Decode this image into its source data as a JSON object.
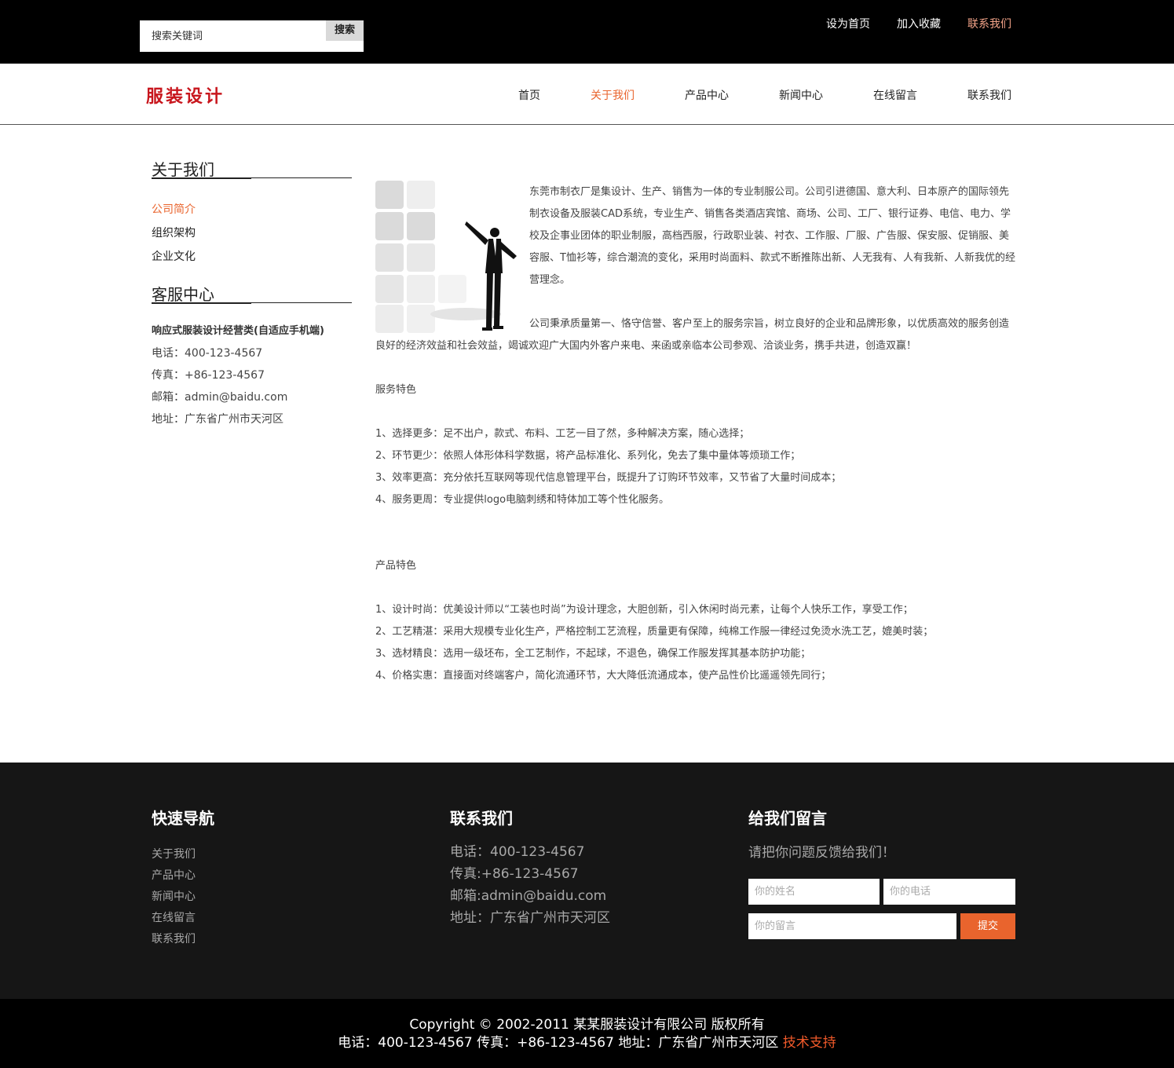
{
  "topbar": {
    "search_placeholder": "搜索关键词",
    "search_button": "搜索",
    "links": [
      "设为首页",
      "加入收藏",
      "联系我们"
    ],
    "active_link": "联系我们"
  },
  "brand": {
    "logo_text": "服装设计"
  },
  "nav": {
    "items": [
      "首页",
      "关于我们",
      "产品中心",
      "新闻中心",
      "在线留言",
      "联系我们"
    ],
    "active_item": "关于我们"
  },
  "sidebar": {
    "about_title": "关于我们",
    "about_items": [
      "公司简介",
      "组织架构",
      "企业文化"
    ],
    "service_title": "客服中心",
    "service_company": "响应式服装设计经营类(自适应手机端)",
    "service_phone": "电话：400-123-4567",
    "service_fax": "传真：+86-123-4567",
    "service_email": "邮箱：admin@baidu.com",
    "service_address": "地址：广东省广州市天河区"
  },
  "content": {
    "para1": "东莞市制衣厂是集设计、生产、销售为一体的专业制服公司。公司引进德国、意大利、日本原产的国际领先制衣设备及服装CAD系统，专业生产、销售各类酒店宾馆、商场、公司、工厂、银行证券、电信、电力、学校及企事业团体的职业制服，高档西服，行政职业装、衬衣、工作服、厂服、广告服、保安服、促销服、美容服、T恤衫等，综合潮流的变化，采用时尚面料、款式不断推陈出新、人无我有、人有我新、人新我优的经营理念。",
    "para2": "公司秉承质量第一、恪守信誉、客户至上的服务宗旨，树立良好的企业和品牌形象，以优质高效的服务创造良好的经济效益和社会效益，竭诚欢迎广大国内外客户来电、来函或亲临本公司参观、洽谈业务，携手共进，创造双赢！",
    "service_heading": "服务特色",
    "service_items": [
      "1、选择更多：足不出户，款式、布料、工艺一目了然，多种解决方案，随心选择；",
      "2、环节更少：依照人体形体科学数据，将产品标准化、系列化，免去了集中量体等烦琐工作；",
      "3、效率更高：充分依托互联网等现代信息管理平台，既提升了订购环节效率，又节省了大量时间成本；",
      "4、服务更周：专业提供logo电脑刺绣和特体加工等个性化服务。"
    ],
    "product_heading": "产品特色",
    "product_items": [
      "1、设计时尚：优美设计师以“工装也时尚”为设计理念，大胆创新，引入休闲时尚元素，让每个人快乐工作，享受工作；",
      "2、工艺精湛：采用大规模专业化生产，严格控制工艺流程，质量更有保障，纯棉工作服一律经过免烫水洗工艺，媲美时装；",
      "3、选材精良：选用一级坯布，全工艺制作，不起球，不退色，确保工作服发挥其基本防护功能；",
      "4、价格实惠：直接面对终端客户，简化流通环节，大大降低流通成本，使产品性价比遥遥领先同行；"
    ]
  },
  "footer": {
    "nav_title": "快速导航",
    "nav_items": [
      "关于我们",
      "产品中心",
      "新闻中心",
      "在线留言",
      "联系我们"
    ],
    "contact_title": "联系我们",
    "contact_phone": "电话：400-123-4567",
    "contact_fax": "传真:+86-123-4567",
    "contact_email": "邮箱:admin@baidu.com",
    "contact_address": "地址：广东省广州市天河区",
    "message_title": "给我们留言",
    "message_prompt": "请把你问题反馈给我们！",
    "name_placeholder": "你的姓名",
    "phone_placeholder": "你的电话",
    "message_placeholder": "你的留言",
    "submit_label": "提交"
  },
  "copyright": {
    "line1": "Copyright © 2002-2011 某某服装设计有限公司 版权所有",
    "line2": "电话：400-123-4567 传真：+86-123-4567 地址：广东省广州市天河区",
    "tech_support": "技术支持"
  },
  "colors": {
    "accent": "#e9642d",
    "logo": "#c8161d",
    "top_active": "#f4a489",
    "footer_bg": "#161616"
  }
}
